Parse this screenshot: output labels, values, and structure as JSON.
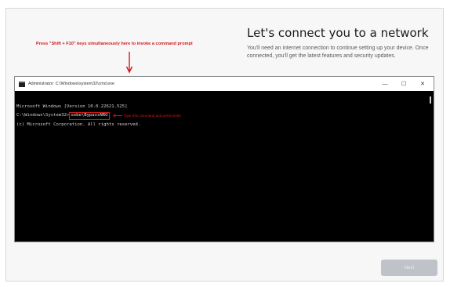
{
  "oobe": {
    "title": "Let's connect you to a network",
    "description": "You'll need an internet connection to continue setting up your device. Once connected, you'll get the latest features and security updates.",
    "next_label": "Next"
  },
  "annotation": {
    "instruction": "Press \"Shift + F10\" keys simultaneously here to invoke a command prompt",
    "type_note": "Type this command and press Enter"
  },
  "cmd": {
    "title": "Administrator: C:\\Windows\\system32\\cmd.exe",
    "minimize": "—",
    "maximize": "☐",
    "close": "✕",
    "line1": "Microsoft Windows [Version 10.0.22621.525]",
    "line2": "(c) Microsoft Corporation. All rights reserved.",
    "prompt": "C:\\Windows\\System32>",
    "command": "oobe\\BypassNRO"
  },
  "colors": {
    "annotation_red": "#d11a1a",
    "console_bg": "#000000",
    "next_disabled": "#bfc3c9"
  }
}
